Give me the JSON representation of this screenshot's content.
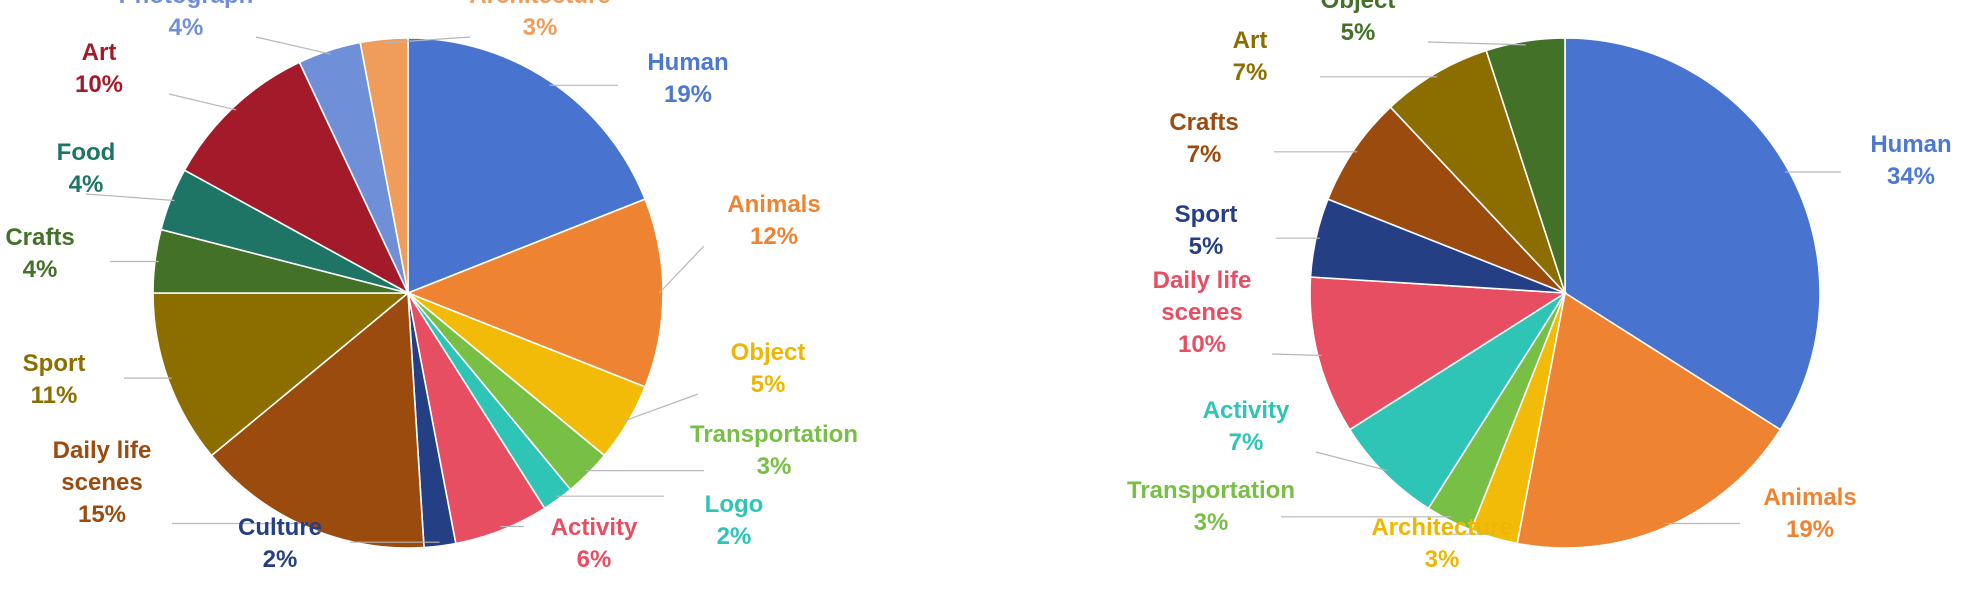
{
  "chart_data": [
    {
      "type": "pie",
      "title": "",
      "start_angle_deg": 0,
      "direction": "clockwise",
      "slices": [
        {
          "label": "Human",
          "display": "19%",
          "value": 19,
          "color": "#4874cf"
        },
        {
          "label": "Animals",
          "display": "12%",
          "value": 12,
          "color": "#ee8432"
        },
        {
          "label": "Object",
          "display": "5%",
          "value": 5,
          "color": "#f2bb07"
        },
        {
          "label": "Transportation",
          "display": "3%",
          "value": 3,
          "color": "#78bf45"
        },
        {
          "label": "Logo",
          "display": "2%",
          "value": 2,
          "color": "#2ec4b6"
        },
        {
          "label": "Activity",
          "display": "6%",
          "value": 6,
          "color": "#e84e62"
        },
        {
          "label": "Culture",
          "display": "2%",
          "value": 2,
          "color": "#243f84"
        },
        {
          "label": "Daily life\nscenes",
          "display": "15%",
          "value": 15,
          "color": "#9c4b0f"
        },
        {
          "label": "Sport",
          "display": "11%",
          "value": 11,
          "color": "#8c6d00"
        },
        {
          "label": "Crafts",
          "display": "4%",
          "value": 4,
          "color": "#427127"
        },
        {
          "label": "Food",
          "display": "4%",
          "value": 4,
          "color": "#1e7565"
        },
        {
          "label": "Art",
          "display": "10%",
          "value": 10,
          "color": "#a31a2a"
        },
        {
          "label": "Photograph",
          "display": "4%",
          "value": 4,
          "color": "#6f90d8"
        },
        {
          "label": "Architecture",
          "display": "3%",
          "value": 3,
          "color": "#f09d5b"
        }
      ]
    },
    {
      "type": "pie",
      "title": "",
      "start_angle_deg": 0,
      "direction": "clockwise",
      "slices": [
        {
          "label": "Human",
          "display": "34%",
          "value": 34,
          "color": "#4874cf"
        },
        {
          "label": "Animals",
          "display": "19%",
          "value": 19,
          "color": "#ee8432"
        },
        {
          "label": "Architecture",
          "display": "3%",
          "value": 3,
          "color": "#f2bb07"
        },
        {
          "label": "Transportation",
          "display": "3%",
          "value": 3,
          "color": "#78bf45"
        },
        {
          "label": "Activity",
          "display": "7%",
          "value": 7,
          "color": "#2ec4b6"
        },
        {
          "label": "Daily life\nscenes",
          "display": "10%",
          "value": 10,
          "color": "#e84e62"
        },
        {
          "label": "Sport",
          "display": "5%",
          "value": 5,
          "color": "#243f84"
        },
        {
          "label": "Crafts",
          "display": "7%",
          "value": 7,
          "color": "#9c4b0f"
        },
        {
          "label": "Art",
          "display": "7%",
          "value": 7,
          "color": "#8c6d00"
        },
        {
          "label": "Object",
          "display": "5%",
          "value": 5,
          "color": "#427127"
        }
      ]
    }
  ]
}
